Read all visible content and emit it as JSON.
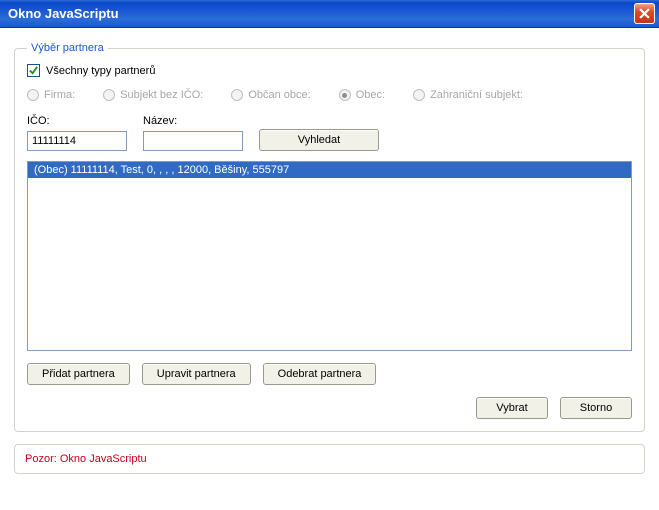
{
  "window": {
    "title": "Okno JavaScriptu"
  },
  "group": {
    "legend": "Výběr partnera",
    "allTypesLabel": "Všechny typy partnerů",
    "radios": {
      "firma": "Firma:",
      "subjektBezIco": "Subjekt bez IČO:",
      "obcanObce": "Občan obce:",
      "obec": "Obec:",
      "zahranicni": "Zahraniční subjekt:"
    },
    "icoLabel": "IČO:",
    "icoValue": "11111114",
    "nazevLabel": "Název:",
    "nazevValue": "",
    "searchBtn": "Vyhledat",
    "listItem0": "(Obec) 11111114, Test, 0, , , , 12000, Běšiny, 555797",
    "addBtn": "Přidat partnera",
    "editBtn": "Upravit partnera",
    "removeBtn": "Odebrat partnera",
    "selectBtn": "Vybrat",
    "cancelBtn": "Storno"
  },
  "warning": {
    "text": "Pozor: Okno JavaScriptu"
  }
}
